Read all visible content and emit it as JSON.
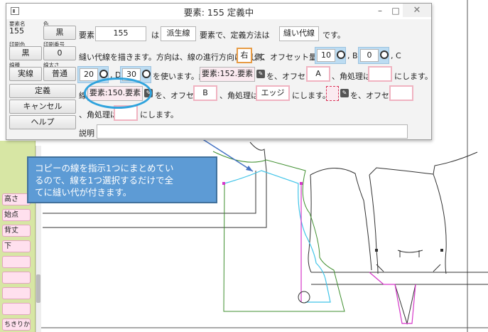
{
  "window": {
    "title": "要素: 155 定義中",
    "minimize": "–",
    "restore": "□",
    "close": "✕"
  },
  "side": {
    "element_name_label": "要素名",
    "element_name": "155",
    "color_label": "色",
    "color_value": "黒",
    "print_color_label": "印刷色",
    "print_color_value": "黒",
    "print_number_label": "印刷番号",
    "print_number_value": "0",
    "line_type_label": "線種",
    "line_type_value": "実線",
    "line_width_label": "線太さ",
    "line_width_value": "普通",
    "define_button": "定義",
    "cancel_button": "キャンセル",
    "help_button": "ヘルプ"
  },
  "form": {
    "row1": {
      "t1": "要素",
      "element": "155",
      "t2": "は",
      "derivation": "派生線",
      "t3": "要素で、定義方法は",
      "method": "縫い代線",
      "t4": "です。"
    },
    "row2": {
      "t1": "縫い代線を描きます。方向は、線の進行方向に対して",
      "direction": "右",
      "t2": "側、オフセット量は、A",
      "a_value": "10",
      "t3": ", B",
      "b_value": "0",
      "t4": ", C"
    },
    "row3": {
      "c_value": "20",
      "t1": ", D",
      "d_value": "30",
      "t2": "を使います。線",
      "line1": "要素:152.要素",
      "t3": "を、オフセット",
      "offset1": "A",
      "t4": "、角処理は",
      "corner1": "",
      "t5": "にします。"
    },
    "row4": {
      "t1": "線",
      "line2": "要素:150.要素",
      "t2": "を、オフセット",
      "offset2": "B",
      "t3": "、角処理は",
      "corner2": "エッジ",
      "t4": "にします。線",
      "line3": "",
      "t5": "を、オフセット",
      "offset3": ""
    },
    "row5": {
      "t1": "、角処理は",
      "corner3": "",
      "t2": "にします。"
    },
    "description_label": "説明",
    "description_value": ""
  },
  "palette": {
    "items": [
      "高さ",
      "始点",
      "背丈",
      "下",
      "",
      "",
      "",
      "",
      "",
      "ちきりかえ"
    ]
  },
  "callout": {
    "line1": "コピーの線を指示1つにまとめてい",
    "line2": "るので、線を1つ選択するだけで全",
    "line3": "てに縫い代が付きます。"
  },
  "colors": {
    "pattern_green": "#3f8f2f",
    "seam_cyan": "#40c4e8",
    "magenta": "#d636c9",
    "orange": "#e79b45",
    "callout_blue": "#5d9bd5",
    "pink_border": "#f0b3c1"
  }
}
